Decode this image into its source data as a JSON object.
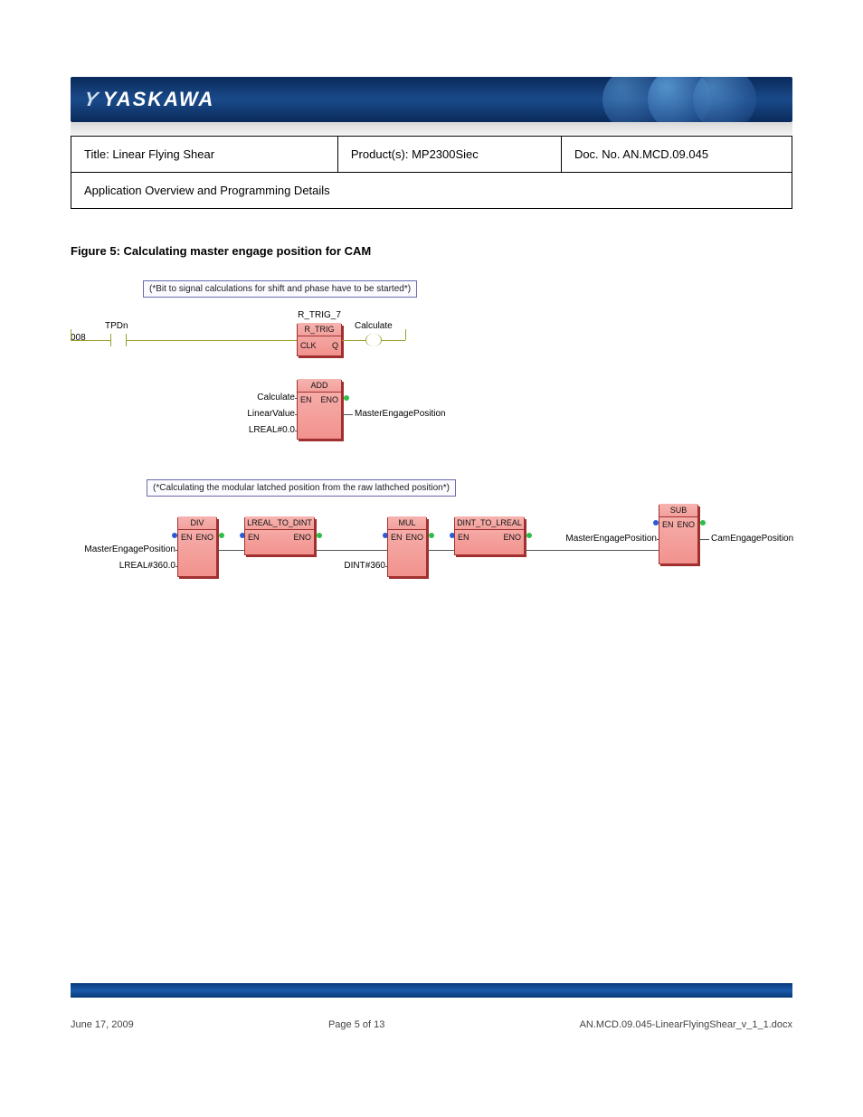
{
  "brand": {
    "name": "YASKAWA",
    "glyph": "Y"
  },
  "info": {
    "title_label": "Title:",
    "title_value": "Linear Flying Shear",
    "product_label": "Product(s):",
    "product_value": "MP2300Siec",
    "doc_label": "Doc. No.",
    "doc_value": "AN.MCD.09.045",
    "subject_label": "Application Overview and Programming Details",
    "subject_value": ""
  },
  "figure5": {
    "title": "Figure 5: Calculating master engage position for CAM",
    "comment1": "(*Bit to signal calculations for shift and phase have to be started*)",
    "comment2": "(*Calculating the modular latched position from the raw lathched position*)",
    "rung1": {
      "number": "008",
      "contact": "TPDn",
      "rtrig_instance": "R_TRIG_7",
      "rtrig_type": "R_TRIG",
      "rtrig_clk": "CLK",
      "rtrig_q": "Q",
      "coil": "Calculate"
    },
    "add_block": {
      "type": "ADD",
      "en": "EN",
      "eno": "ENO",
      "in_en": "Calculate",
      "in1": "LinearValue",
      "in2": "LREAL#0.0",
      "out": "MasterEngagePosition"
    },
    "chain": {
      "div": {
        "type": "DIV",
        "en": "EN",
        "eno": "ENO",
        "in1": "MasterEngagePosition",
        "in2": "LREAL#360.0"
      },
      "l2d": {
        "type": "LREAL_TO_DINT",
        "en": "EN",
        "eno": "ENO"
      },
      "mul": {
        "type": "MUL",
        "en": "EN",
        "eno": "ENO",
        "in2": "DINT#360"
      },
      "d2l": {
        "type": "DINT_TO_LREAL",
        "en": "EN",
        "eno": "ENO"
      },
      "sub": {
        "type": "SUB",
        "en": "EN",
        "eno": "ENO",
        "in1": "MasterEngagePosition",
        "out": "CamEngagePosition"
      }
    }
  },
  "footer": {
    "date": "June 17, 2009",
    "page": "Page 5 of 13",
    "file": "AN.MCD.09.045-LinearFlyingShear_v_1_1.docx"
  }
}
